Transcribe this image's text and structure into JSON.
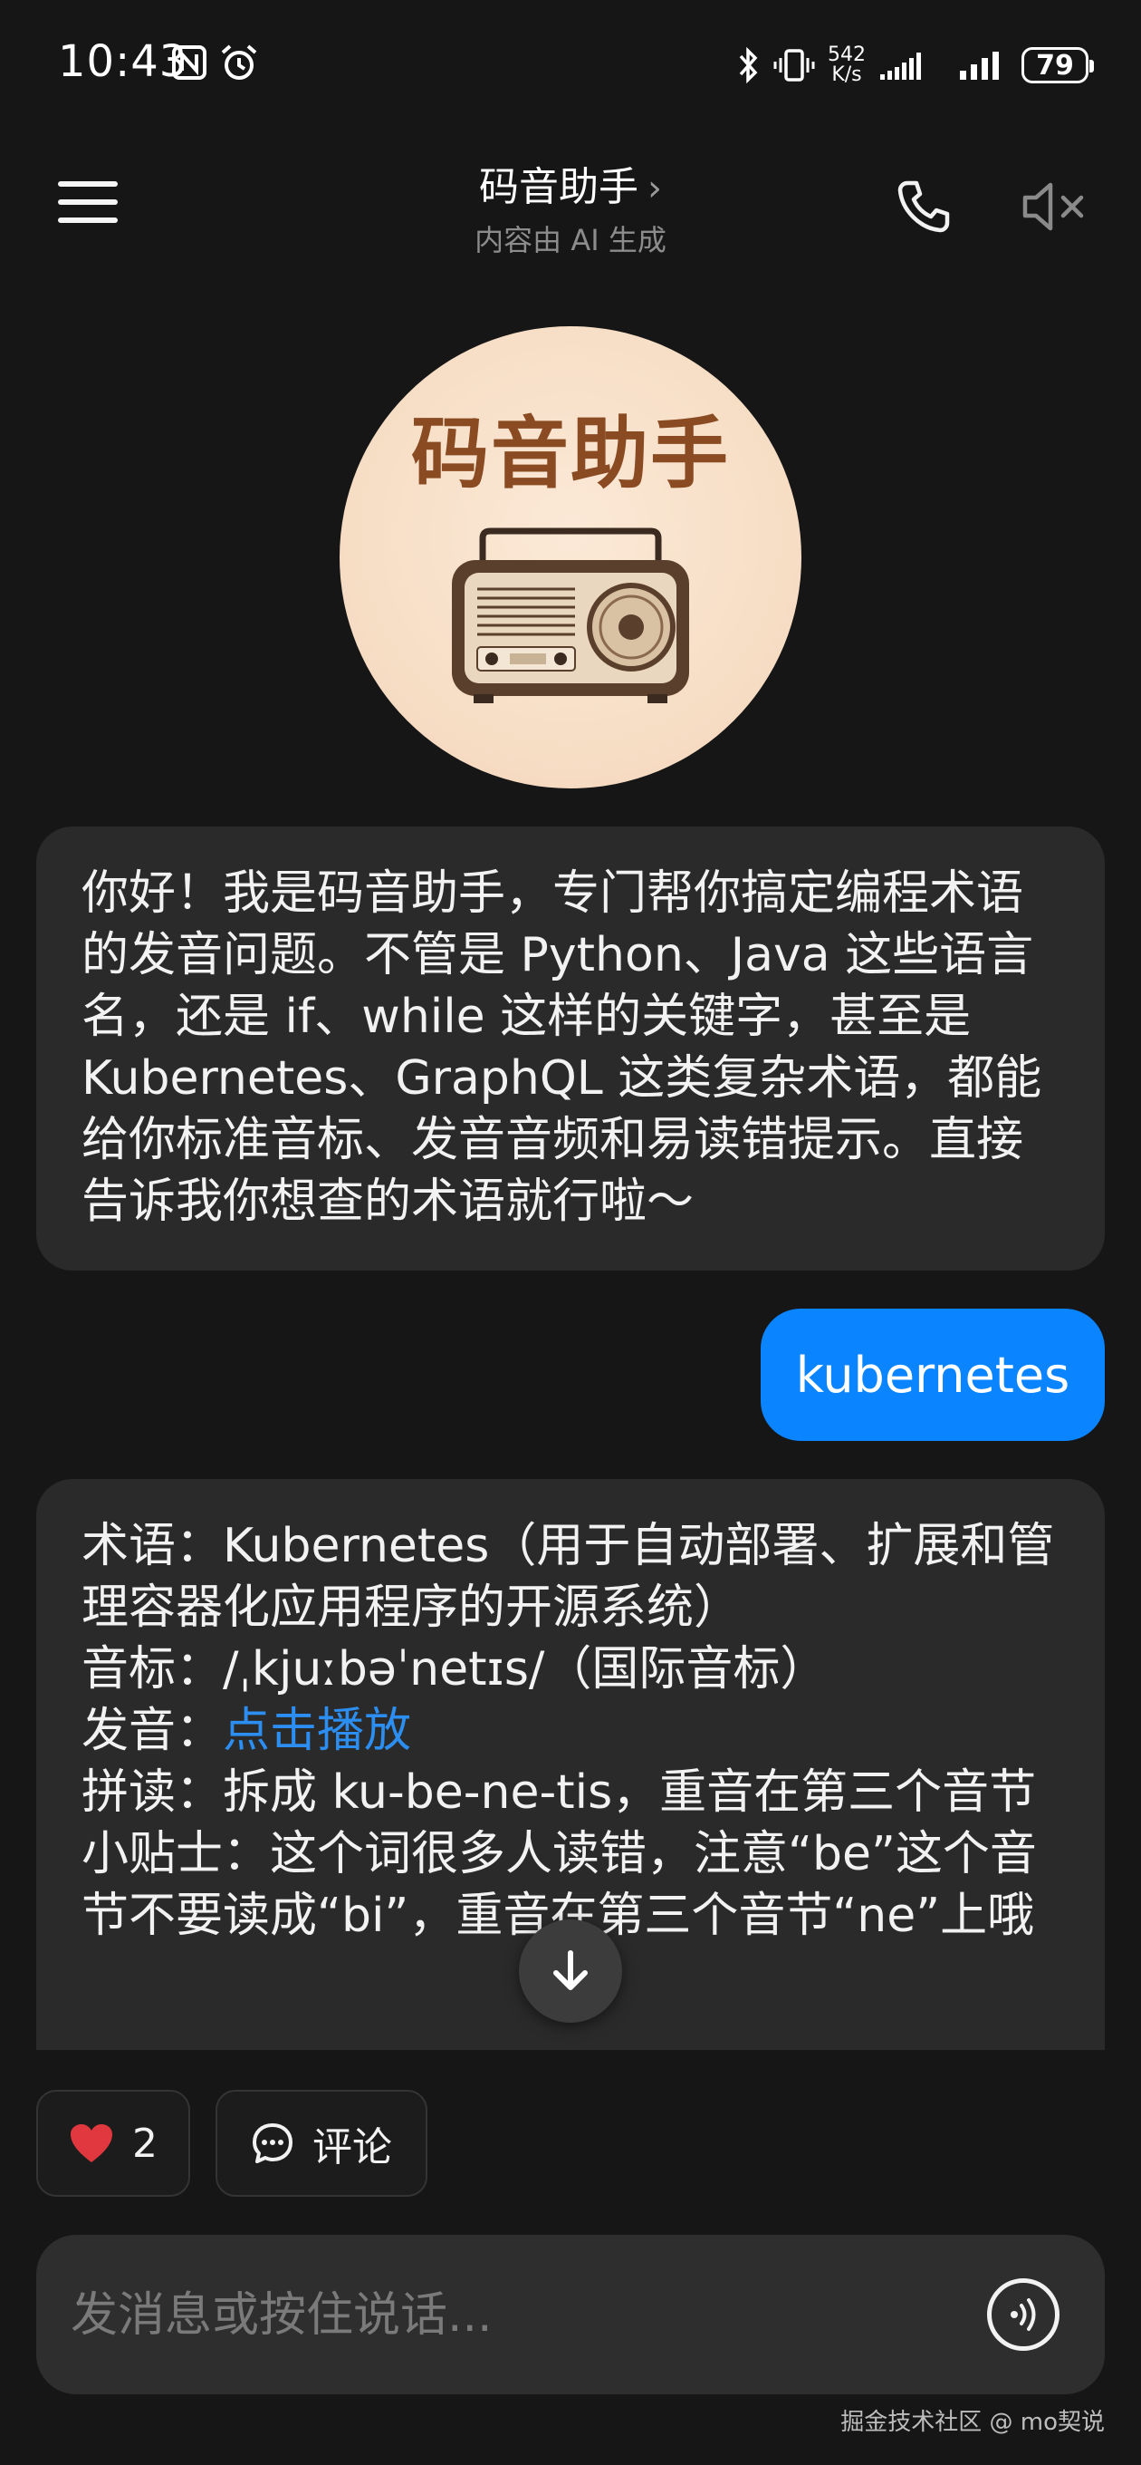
{
  "status_bar": {
    "time": "10:43",
    "net_speed_value": "542",
    "net_speed_unit": "K/s",
    "battery": "79"
  },
  "header": {
    "title": "码音助手",
    "chevron": "›",
    "subtitle": "内容由 AI 生成"
  },
  "avatar": {
    "title": "码音助手"
  },
  "messages": {
    "greeting": "你好！我是码音助手，专门帮你搞定编程术语的发音问题。不管是 Python、Java 这些语言名，还是 if、while 这样的关键字，甚至是 Kubernetes、GraphQL 这类复杂术语，都能给你标准音标、发音音频和易读错提示。直接告诉我你想查的术语就行啦～",
    "user_query": "kubernetes",
    "answer": {
      "term_label": "术语：",
      "term_value": "Kubernetes（用于自动部署、扩展和管理容器化应用程序的开源系统）",
      "ipa_label": "音标：",
      "ipa_value": "/ˌkjuːbəˈnetɪs/（国际音标）",
      "audio_label": "发音：",
      "audio_link": "点击播放",
      "syllable_label": "拼读：",
      "syllable_value": "拆成 ku-be-ne-tis，重音在第三个音节",
      "tip_label": "小贴士：",
      "tip_value": "这个词很多人读错，注意“be”这个音节不要读成“bi”，重音在第三个音节“ne”上哦"
    }
  },
  "reactions": {
    "like_count": "2",
    "comment_label": "评论"
  },
  "composer": {
    "placeholder": "发消息或按住说话..."
  },
  "watermark": "掘金技术社区 @ mo契说",
  "colors": {
    "background": "#161616",
    "bubble_bot": "#2a2a2a",
    "bubble_user": "#0a84ff",
    "link": "#2b8ef0",
    "like": "#e0383e"
  },
  "icons": [
    "nfc-icon",
    "alarm-icon",
    "bluetooth-icon",
    "vibrate-icon",
    "signal-icon",
    "menu-icon",
    "phone-icon",
    "speaker-muted-icon",
    "arrow-down-icon",
    "heart-icon",
    "comment-icon",
    "voice-icon"
  ]
}
